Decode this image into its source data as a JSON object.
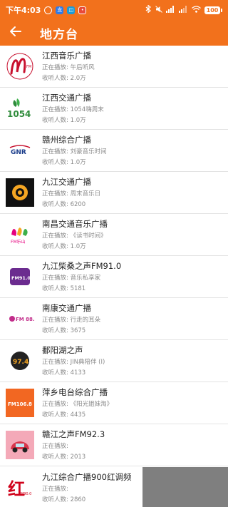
{
  "status_bar": {
    "time": "下午4:03",
    "network_speed": "",
    "battery": "100"
  },
  "header": {
    "title": "地方台",
    "back_icon": "arrow-left-icon"
  },
  "labels": {
    "now_playing": "正在播放:",
    "listeners": "收听人数:"
  },
  "stations": [
    {
      "name": "江西音乐广播",
      "now_playing": "午后听风",
      "listeners": "2.0万",
      "logo": "jiangxi-music-logo"
    },
    {
      "name": "江西交通广播",
      "now_playing": "1054嗨周末",
      "listeners": "1.0万",
      "logo": "jiangxi-traffic-1054-logo"
    },
    {
      "name": "赣州综合广播",
      "now_playing": "刘豪音乐时间",
      "listeners": "1.0万",
      "logo": "ganzhou-gnr-logo"
    },
    {
      "name": "九江交通广播",
      "now_playing": "周末音乐日",
      "listeners": "6200",
      "logo": "jiujiang-traffic-logo"
    },
    {
      "name": "南昌交通音乐广播",
      "now_playing": "《读书时间》",
      "listeners": "1.0万",
      "logo": "nanchang-fm-logo"
    },
    {
      "name": "九江柴桑之声FM91.0",
      "now_playing": "音乐私享家",
      "listeners": "5181",
      "logo": "chaisang-logo"
    },
    {
      "name": "南康交通广播",
      "now_playing": "行走的耳朵",
      "listeners": "3675",
      "logo": "nankang-fm884-logo"
    },
    {
      "name": "鄱阳湖之声",
      "now_playing": "JIN典陪伴 (I)",
      "listeners": "4133",
      "logo": "poyanghu-974-logo"
    },
    {
      "name": "萍乡电台综合广播",
      "now_playing": "《阳光姐妹淘》",
      "listeners": "4435",
      "logo": "pingxiang-1068-logo"
    },
    {
      "name": "赣江之声FM92.3",
      "now_playing": "",
      "listeners": "2013",
      "logo": "ganjiang-car-logo"
    },
    {
      "name": "九江综合广播900红调频",
      "now_playing": "",
      "listeners": "2860",
      "logo": "jiujiang-hong-logo"
    }
  ],
  "logo_texts": {
    "s2": "1054",
    "s3": "GNR",
    "s5": "FM乐山",
    "s6": "FM91.0",
    "s7": "FM 88.4",
    "s8": "97.4",
    "s9": "FM106.8",
    "s11a": "红",
    "s11b": "FM90.0"
  },
  "colors": {
    "accent": "#f2711c",
    "divider": "#e3e3e3",
    "title_text": "#222222",
    "sub_text": "#8a8a8a"
  }
}
